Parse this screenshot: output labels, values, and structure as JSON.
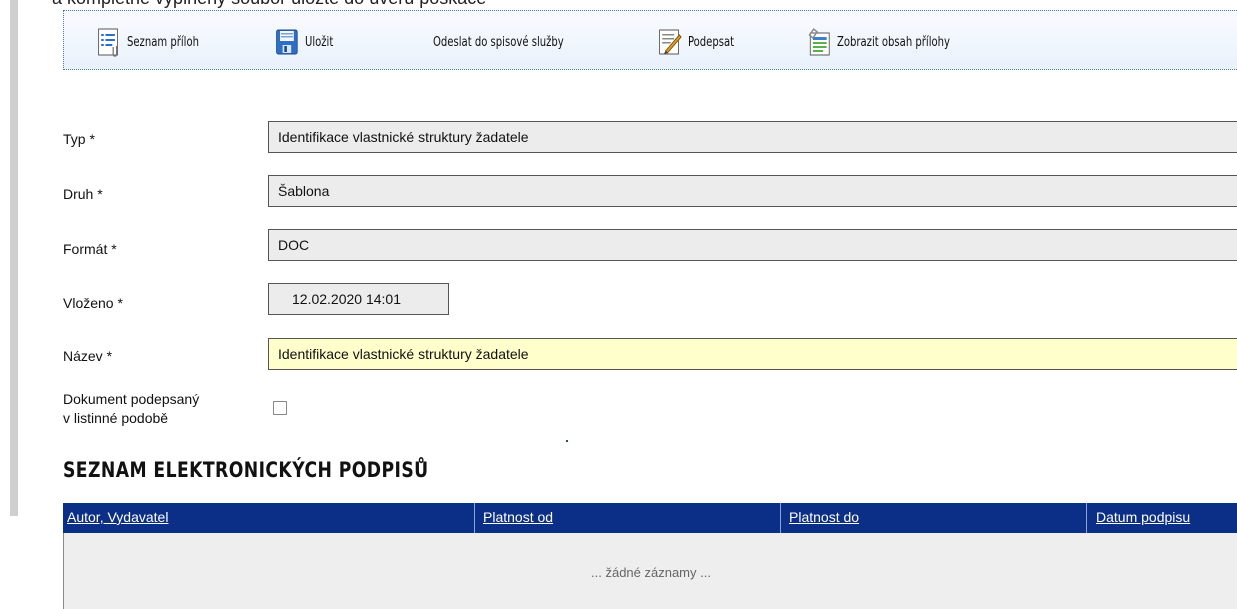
{
  "header": {
    "cut_text": "a kompletně vyplněný soubor uložte do úvěrů poskace"
  },
  "toolbar": {
    "list_label": "Seznam příloh",
    "save_label": "Uložit",
    "send_label": "Odeslat do spisové služby",
    "sign_label": "Podepsat",
    "view_label": "Zobrazit obsah přílohy"
  },
  "form": {
    "typ_label": "Typ *",
    "typ_value": "Identifikace vlastnické struktury žadatele",
    "druh_label": "Druh *",
    "druh_value": "Šablona",
    "format_label": "Formát *",
    "format_value": "DOC",
    "vlozeno_label": "Vloženo *",
    "vlozeno_value": "12.02.2020 14:01",
    "nazev_label": "Název *",
    "nazev_value": "Identifikace vlastnické struktury žadatele",
    "signed_label_line1": "Dokument podepsaný",
    "signed_label_line2": "v listinné podobě",
    "signed_checked": false
  },
  "signatures": {
    "title": "SEZNAM ELEKTRONICKÝCH PODPISŮ",
    "columns": [
      "Autor, Vydavatel",
      "Platnost od",
      "Platnost do",
      "Datum podpisu"
    ],
    "empty_text": "... žádné záznamy ..."
  },
  "colors": {
    "header_bg": "#0b2f86",
    "name_field_bg": "#ffffcc",
    "readonly_field_bg": "#ececec"
  }
}
